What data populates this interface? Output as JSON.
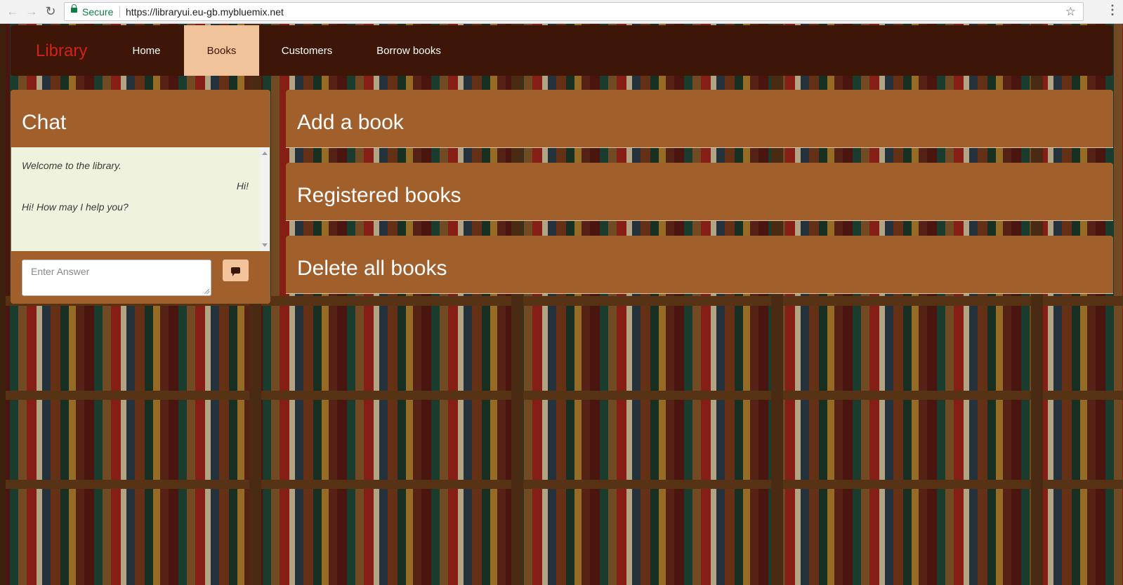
{
  "browser": {
    "secure_label": "Secure",
    "url": "https://libraryui.eu-gb.mybluemix.net",
    "icons": [
      "back-arrow-icon",
      "forward-arrow-icon",
      "reload-icon",
      "lock-icon",
      "star-icon",
      "menu-dots-icon"
    ]
  },
  "navbar": {
    "brand": "Library",
    "items": [
      {
        "label": "Home",
        "active": false
      },
      {
        "label": "Books",
        "active": true
      },
      {
        "label": "Customers",
        "active": false
      },
      {
        "label": "Borrow books",
        "active": false
      }
    ]
  },
  "chat": {
    "title": "Chat",
    "messages": [
      {
        "from": "bot",
        "text": "Welcome to the library."
      },
      {
        "from": "user",
        "text": "Hi!"
      },
      {
        "from": "bot",
        "text": "Hi! How may I help you?"
      }
    ],
    "input_placeholder": "Enter Answer",
    "send_icon": "chat-bubble-icon"
  },
  "panels": [
    {
      "title": "Add a book"
    },
    {
      "title": "Registered books"
    },
    {
      "title": "Delete all books"
    }
  ],
  "colors": {
    "navbar_bg": "#3d1608",
    "brand": "#d2231b",
    "active_tab": "#f1c39a",
    "panel_bg": "#a15f2c",
    "chat_log_bg": "#eff3dd"
  }
}
